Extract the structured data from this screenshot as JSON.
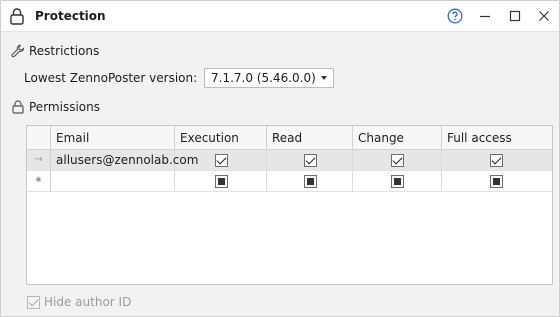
{
  "window": {
    "title": "Protection",
    "help_icon": "help-circle-icon",
    "minimize_icon": "minimize-icon",
    "maximize_icon": "maximize-icon",
    "close_icon": "close-icon"
  },
  "restrictions": {
    "title": "Restrictions",
    "icon": "wrench-icon",
    "version_label": "Lowest ZennoPoster version:",
    "version_value": "7.1.7.0 (5.46.0.0)"
  },
  "permissions": {
    "title": "Permissions",
    "icon": "lock-icon",
    "columns": [
      "Email",
      "Execution",
      "Read",
      "Change",
      "Full access"
    ],
    "rows": [
      {
        "indicator": "→",
        "email": "allusers@zennolab.com",
        "execution": "checked",
        "read": "checked",
        "change": "checked",
        "full_access": "checked"
      },
      {
        "indicator": "✷",
        "email": "",
        "execution": "indeterminate",
        "read": "indeterminate",
        "change": "indeterminate",
        "full_access": "indeterminate"
      }
    ]
  },
  "footer": {
    "hide_author_label": "Hide author ID",
    "hide_author_checked": true,
    "hide_author_disabled": true
  }
}
